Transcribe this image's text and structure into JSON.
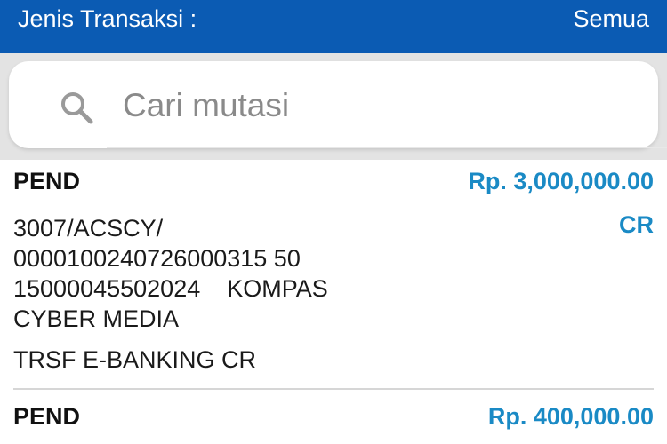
{
  "header": {
    "filter_label": "Jenis Transaksi :",
    "filter_value": "Semua",
    "background": "#0b5bb3"
  },
  "search": {
    "placeholder": "Cari mutasi",
    "icon": "search-icon"
  },
  "transactions": [
    {
      "status": "PEND",
      "amount": "Rp. 3,000,000.00",
      "type": "CR",
      "description_lines": [
        "3007/ACSCY/",
        "0000100240726000315 50",
        "15000045502024    KOMPAS",
        "CYBER MEDIA"
      ],
      "remark": "TRSF E-BANKING CR"
    },
    {
      "status": "PEND",
      "amount": "Rp. 400,000.00"
    }
  ],
  "colors": {
    "accent": "#1a8ac5",
    "search_zone": "#e3e3e3"
  }
}
